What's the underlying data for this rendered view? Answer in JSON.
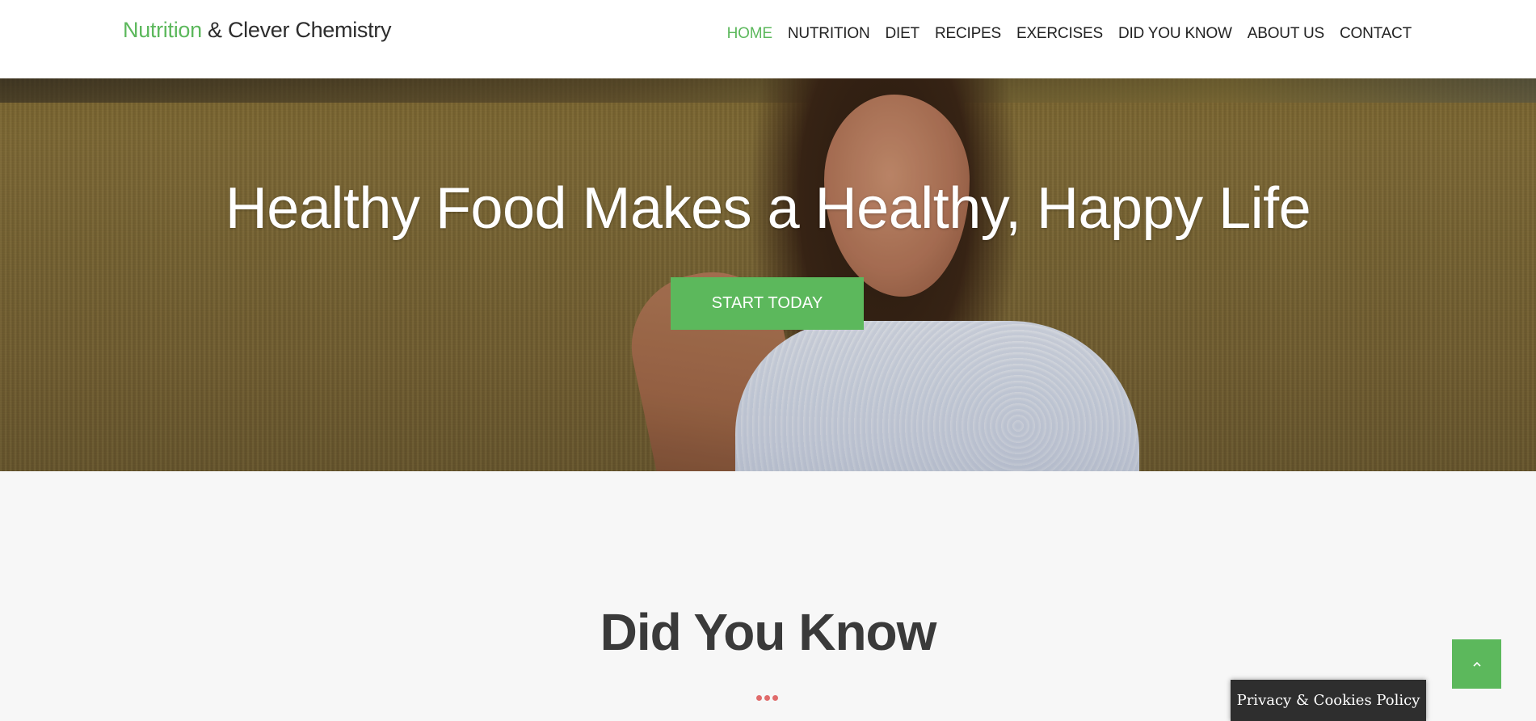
{
  "header": {
    "logo_accent": "Nutrition",
    "logo_rest": " & Clever Chemistry",
    "nav": [
      {
        "label": "HOME",
        "active": true
      },
      {
        "label": "NUTRITION",
        "active": false
      },
      {
        "label": "DIET",
        "active": false
      },
      {
        "label": "RECIPES",
        "active": false
      },
      {
        "label": "EXERCISES",
        "active": false
      },
      {
        "label": "DID YOU KNOW",
        "active": false
      },
      {
        "label": "ABOUT US",
        "active": false
      },
      {
        "label": "CONTACT",
        "active": false
      }
    ]
  },
  "hero": {
    "title": "Healthy Food Makes a Healthy, Happy Life",
    "cta_label": "START TODAY"
  },
  "section": {
    "title": "Did You Know"
  },
  "floating": {
    "back_to_top_icon": "chevron-up-icon",
    "privacy_label": "Privacy & Cookies Policy"
  },
  "colors": {
    "accent": "#5cb85c",
    "dots": "#e06b6b",
    "text_dark": "#3a3a3a"
  }
}
